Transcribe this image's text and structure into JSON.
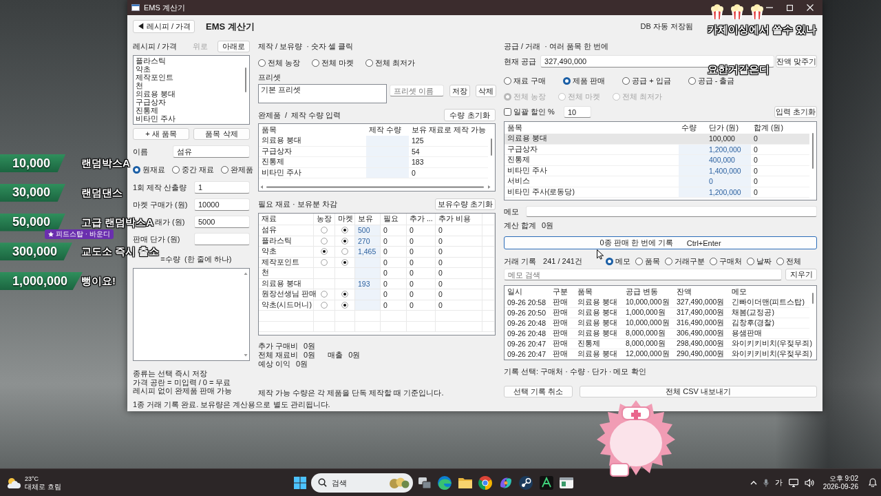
{
  "overlay": {
    "donations": [
      {
        "amount": "10,000",
        "label": "랜덤박스A"
      },
      {
        "amount": "30,000",
        "label": "랜덤댄스"
      },
      {
        "amount": "50,000",
        "label": "고급 랜덤박스A"
      },
      {
        "amount": "300,000",
        "label": "교도소 즉시 출소"
      },
      {
        "amount": "1,000,000",
        "label": "뻥이요!"
      }
    ],
    "sponsor_tag": "피드스탑 · 바운디",
    "captions": [
      "카체이싱에서 쓸수 있나",
      "요한거같은디"
    ]
  },
  "window": {
    "title": "EMS 계산기",
    "back_button": "◀ 레시피 / 가격",
    "heading": "EMS 계산기",
    "save_status": "DB 자동 저장됨",
    "status": "1종 거래 기록 완료. 보유량은 계산용으로 별도 관리됩니다."
  },
  "recipes": {
    "title": "레시피 / 가격",
    "move_buttons": [
      {
        "label": "위로",
        "disabled": true
      },
      {
        "label": "아래로",
        "disabled": false
      }
    ],
    "items": [
      "플라스틱",
      "약초",
      "제작포인트",
      "천",
      "의료용 붕대",
      "구급상자",
      "진통제",
      "비타민 주사"
    ],
    "actions": [
      "+ 새 품목",
      "품목 삭제"
    ],
    "name_label": "이름",
    "name_value": "섬유",
    "types": [
      {
        "label": "원재료",
        "selected": true
      },
      {
        "label": "중간 재료",
        "selected": false
      },
      {
        "label": "완제품",
        "selected": false
      }
    ],
    "fields": [
      {
        "label": "1회 제작 산출량",
        "value": "1"
      },
      {
        "label": "마켓 구매가 (원)",
        "value": "10000"
      },
      {
        "label": "래가 (원)",
        "value": "5000"
      },
      {
        "label": "판매 단가 (원)"
      }
    ],
    "ingredients_label": "=수량  (한 줄에 하나)",
    "notes": [
      "종류는 선택 즉시 저장",
      "가격 공란 = 미입력 / 0 = 무료",
      "레시피 없이 완제품 판매 가능"
    ]
  },
  "crafting": {
    "title": "제작 / 보유량  · 숫자 셀 클릭",
    "sources": [
      {
        "label": "전체 농장",
        "selected": false
      },
      {
        "label": "전체 마켓",
        "selected": false
      },
      {
        "label": "전체 최저가",
        "selected": false
      }
    ],
    "preset_label": "프리셋",
    "presets": [
      "기본 프리셋"
    ],
    "preset_placeholder": "프리셋 이름",
    "preset_buttons": [
      "저장",
      "삭제"
    ],
    "products_title": "완제품  /  제작 수량 입력",
    "products_reset": "수량 초기화",
    "products_table": {
      "columns": [
        "품목",
        "제작 수량",
        "보유 재료로 제작 가능"
      ],
      "rows": [
        {
          "item": "의료용 붕대",
          "craftable": "125"
        },
        {
          "item": "구급상자",
          "craftable": "54"
        },
        {
          "item": "진통제",
          "craftable": "183"
        },
        {
          "item": "비타민 주사",
          "craftable": "0"
        }
      ]
    },
    "materials_title": "필요 재료 · 보유분 차감",
    "materials_reset": "보유수량 초기화",
    "materials_table": {
      "columns": [
        "재료",
        "농장",
        "마켓",
        "보유",
        "필요",
        "추가 ...",
        "추가 비용"
      ],
      "rows": [
        {
          "name": "섬유",
          "farm": false,
          "market": true,
          "owned": "500",
          "needed": "0",
          "extra": "0",
          "extra_cost": "0"
        },
        {
          "name": "플라스틱",
          "farm": false,
          "market": true,
          "owned": "270",
          "needed": "0",
          "extra": "0",
          "extra_cost": "0"
        },
        {
          "name": "약초",
          "farm": true,
          "market": false,
          "owned": "1,465",
          "needed": "0",
          "extra": "0",
          "extra_cost": "0"
        },
        {
          "name": "제작포인트",
          "farm": false,
          "market": true,
          "needed": "0",
          "extra": "0",
          "extra_cost": "0"
        },
        {
          "name": "천",
          "needed": "0",
          "extra": "0",
          "extra_cost": "0"
        },
        {
          "name": "의료용 붕대",
          "owned": "193",
          "needed": "0",
          "extra": "0",
          "extra_cost": "0"
        },
        {
          "name": "원장선생님 판매",
          "farm": false,
          "market": true,
          "needed": "0",
          "extra": "0",
          "extra_cost": "0"
        },
        {
          "name": "약초(시드머니)",
          "farm": false,
          "market": true,
          "needed": "0",
          "extra": "0",
          "extra_cost": "0"
        }
      ]
    },
    "totals": [
      [
        {
          "label": "추가 구매비",
          "value": "0원"
        }
      ],
      [
        {
          "label": "전체 재료비",
          "value": "0원"
        },
        {
          "label": "매출",
          "value": "0원"
        }
      ],
      [
        {
          "label": "예상 이익",
          "value": "0원"
        }
      ]
    ],
    "footnote": "제작 가능 수량은 각 제품을 단독 제작할 때 기준입니다."
  },
  "supply": {
    "title": "공급 / 거래  · 여러 품목 한 번에",
    "balance_label": "현재 공급",
    "balance_value": "327,490,000",
    "balance_button": "잔액 맞주기",
    "modes": [
      {
        "label": "재료 구매",
        "selected": false
      },
      {
        "label": "제품 판매",
        "selected": true
      },
      {
        "label": "공급 + 입금",
        "selected": false
      },
      {
        "label": "공급 - 출금",
        "selected": false
      }
    ],
    "price_sources": [
      {
        "label": "전체 농장",
        "selected": true,
        "disabled": true
      },
      {
        "label": "전체 마켓",
        "selected": false,
        "disabled": true
      },
      {
        "label": "전체 최저가",
        "selected": false,
        "disabled": true
      }
    ],
    "discount": {
      "label": "일괄 할인 %",
      "checked": false,
      "value": "10"
    },
    "reset_button": "입력 초기화",
    "table": {
      "columns": [
        "품목",
        "수량",
        "단가 (원)",
        "합계 (원)"
      ],
      "rows": [
        {
          "item": "의료용 붕대",
          "price": "100,000",
          "total": "0",
          "selected": true
        },
        {
          "item": "구급상자",
          "price": "1,200,000",
          "total": "0",
          "selected": false
        },
        {
          "item": "진통제",
          "price": "400,000",
          "total": "0",
          "selected": false
        },
        {
          "item": "비타민 주사",
          "price": "1,400,000",
          "total": "0",
          "selected": false
        },
        {
          "item": "서비스",
          "price": "0",
          "total": "0",
          "selected": false
        },
        {
          "item": "비타민 주사(로동당)",
          "price": "1,200,000",
          "total": "0",
          "selected": false
        }
      ]
    },
    "memo_label": "메모",
    "total_label": "계산 합계",
    "total_value": "0원",
    "record_button": "0종 판매 한 번에 기록",
    "record_shortcut": "Ctrl+Enter"
  },
  "history": {
    "title": "거래 기록",
    "count": "241 / 241건",
    "filters": [
      {
        "label": "메모",
        "selected": true
      },
      {
        "label": "품목",
        "selected": false
      },
      {
        "label": "거래구분",
        "selected": false
      },
      {
        "label": "구매처",
        "selected": false
      },
      {
        "label": "날짜",
        "selected": false
      },
      {
        "label": "전체",
        "selected": false
      }
    ],
    "search_placeholder": "메모 검색",
    "clear_button": "지우기",
    "table": {
      "columns": [
        "일시",
        "구분",
        "품목",
        "공급 변동",
        "잔액",
        "메모"
      ],
      "rows": [
        {
          "time": "09-26 20:58",
          "type": "판매",
          "item": "의료용 붕대",
          "change": "10,000,000원",
          "balance": "327,490,000원",
          "memo": "긴빠이더맨(피트스탑)"
        },
        {
          "time": "09-26 20:50",
          "type": "판매",
          "item": "의료용 붕대",
          "change": "1,000,000원",
          "balance": "317,490,000원",
          "memo": "채봄(교정공)"
        },
        {
          "time": "09-26 20:48",
          "type": "판매",
          "item": "의료용 붕대",
          "change": "10,000,000원",
          "balance": "316,490,000원",
          "memo": "김창후(경찰)"
        },
        {
          "time": "09-26 20:48",
          "type": "판매",
          "item": "의료용 붕대",
          "change": "8,000,000원",
          "balance": "306,490,000원",
          "memo": "용샘판매"
        },
        {
          "time": "09-26 20:47",
          "type": "판매",
          "item": "진통제",
          "change": "8,000,000원",
          "balance": "298,490,000원",
          "memo": "와이키키비치(우젖무죄)"
        },
        {
          "time": "09-26 20:47",
          "type": "판매",
          "item": "의료용 붕대",
          "change": "12,000,000원",
          "balance": "290,490,000원",
          "memo": "와이키키비치(우젖무죄)"
        }
      ]
    },
    "hint": "기록 선택: 구매처 · 수량 · 단가 · 메모 확인",
    "buttons": [
      "선택 기록 취소",
      "전체 CSV 내보내기"
    ]
  },
  "taskbar": {
    "weather_temp": "23°C",
    "weather_text": "대체로 흐림",
    "search_placeholder": "검색",
    "ime": "가",
    "time": "오후 9:02",
    "date": "2026-09-26"
  }
}
